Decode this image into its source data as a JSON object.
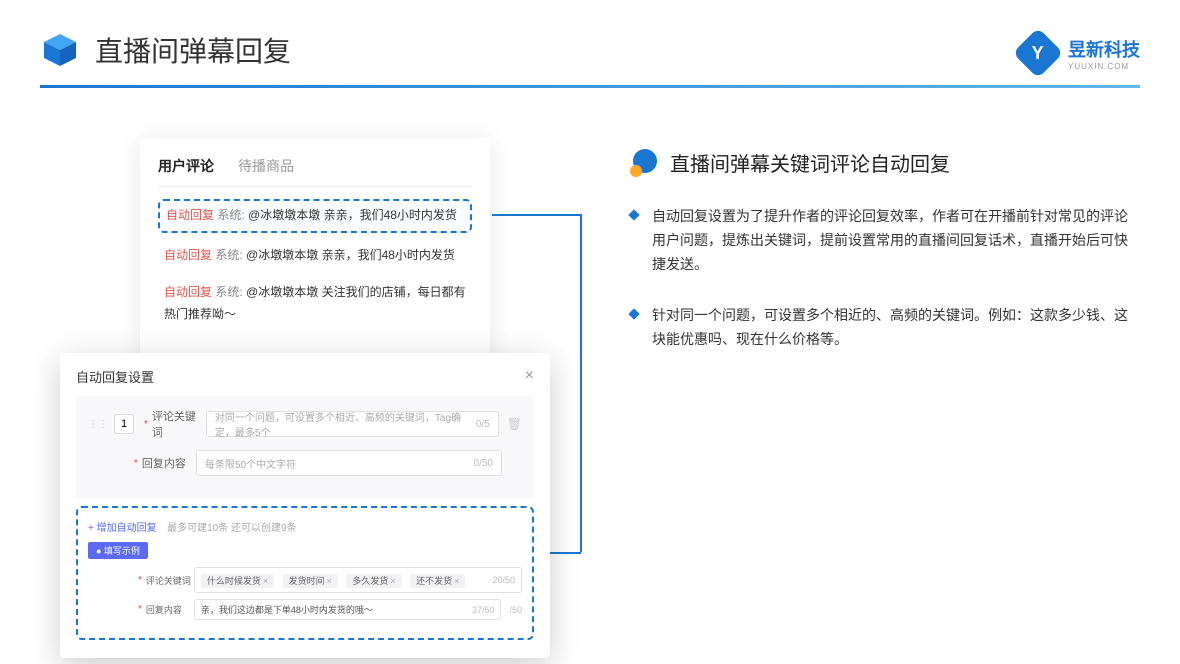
{
  "header": {
    "title": "直播间弹幕回复"
  },
  "brand": {
    "name": "昱新科技",
    "sub": "YUUXIN.COM"
  },
  "comments": {
    "tabs": {
      "active": "用户评论",
      "inactive": "待播商品"
    },
    "items": [
      {
        "tag": "自动回复",
        "sys": "系统:",
        "user": "@冰墩墩本墩",
        "text": "亲亲，我们48小时内发货"
      },
      {
        "tag": "自动回复",
        "sys": "系统:",
        "user": "@冰墩墩本墩",
        "text": "亲亲，我们48小时内发货"
      },
      {
        "tag": "自动回复",
        "sys": "系统:",
        "user": "@冰墩墩本墩",
        "text": "关注我们的店铺，每日都有热门推荐呦～"
      }
    ]
  },
  "settings": {
    "title": "自动回复设置",
    "row_num": "1",
    "keyword_label": "评论关键词",
    "keyword_placeholder": "对同一个问题，可设置多个相近、高频的关键词，Tag确定，最多5个",
    "keyword_counter": "0/5",
    "content_label": "回复内容",
    "content_placeholder": "每条限50个中文字符",
    "content_counter": "0/50",
    "add_link": "+ 增加自动回复",
    "add_hint": "最多可建10条 还可以创建9条",
    "example_badge": "● 填写示例",
    "example_keyword_label": "评论关键词",
    "example_tags": [
      "什么时候发货",
      "发货时间",
      "多久发货",
      "还不发货"
    ],
    "example_keyword_counter": "20/50",
    "example_content_label": "回复内容",
    "example_content": "亲，我们这边都是下单48小时内发货的哦～",
    "example_content_counter": "37/50",
    "outer_counter": "/50"
  },
  "right": {
    "section_title": "直播间弹幕关键词评论自动回复",
    "bullets": [
      "自动回复设置为了提升作者的评论回复效率，作者可在开播前针对常见的评论用户问题，提炼出关键词，提前设置常用的直播间回复话术，直播开始后可快捷发送。",
      "针对同一个问题，可设置多个相近的、高频的关键词。例如：这款多少钱、这块能优惠吗、现在什么价格等。"
    ]
  }
}
